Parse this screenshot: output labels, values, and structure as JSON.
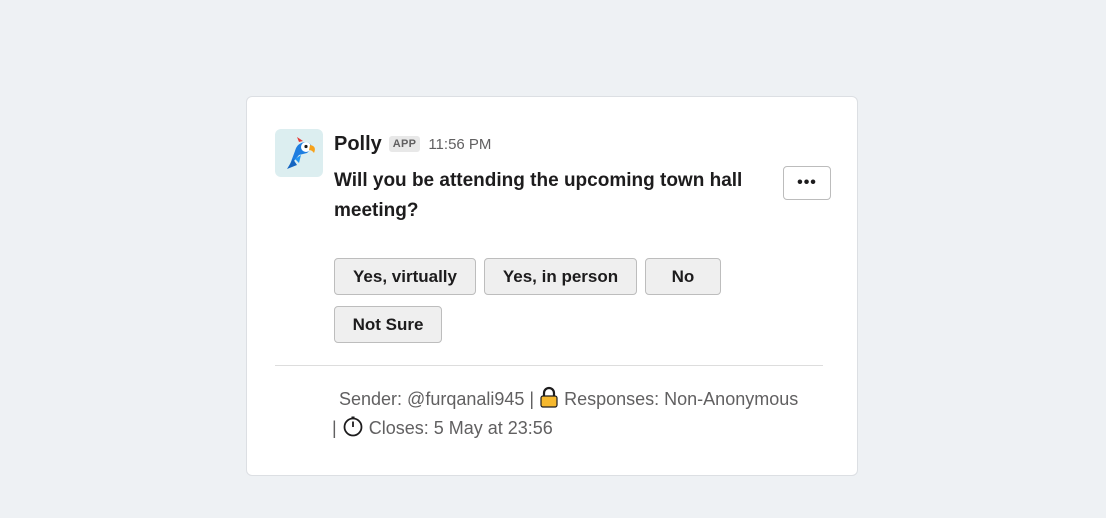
{
  "message": {
    "avatar_icon": "parrot-logo-icon",
    "app_name": "Polly",
    "app_badge": "APP",
    "timestamp": "11:56 PM",
    "question": "Will you be attending the upcoming town hall meeting?",
    "more_button": "•••"
  },
  "options": [
    {
      "label": "Yes, virtually"
    },
    {
      "label": "Yes, in person"
    },
    {
      "label": "No"
    },
    {
      "label": "Not Sure"
    }
  ],
  "footer": {
    "sender": "Sender: @furqanali945 |",
    "responses": "Responses: Non-Anonymous",
    "separator": "|",
    "closes": "Closes: 5 May at 23:56",
    "lock_icon": "lock-icon",
    "timer_icon": "stopwatch-icon"
  }
}
